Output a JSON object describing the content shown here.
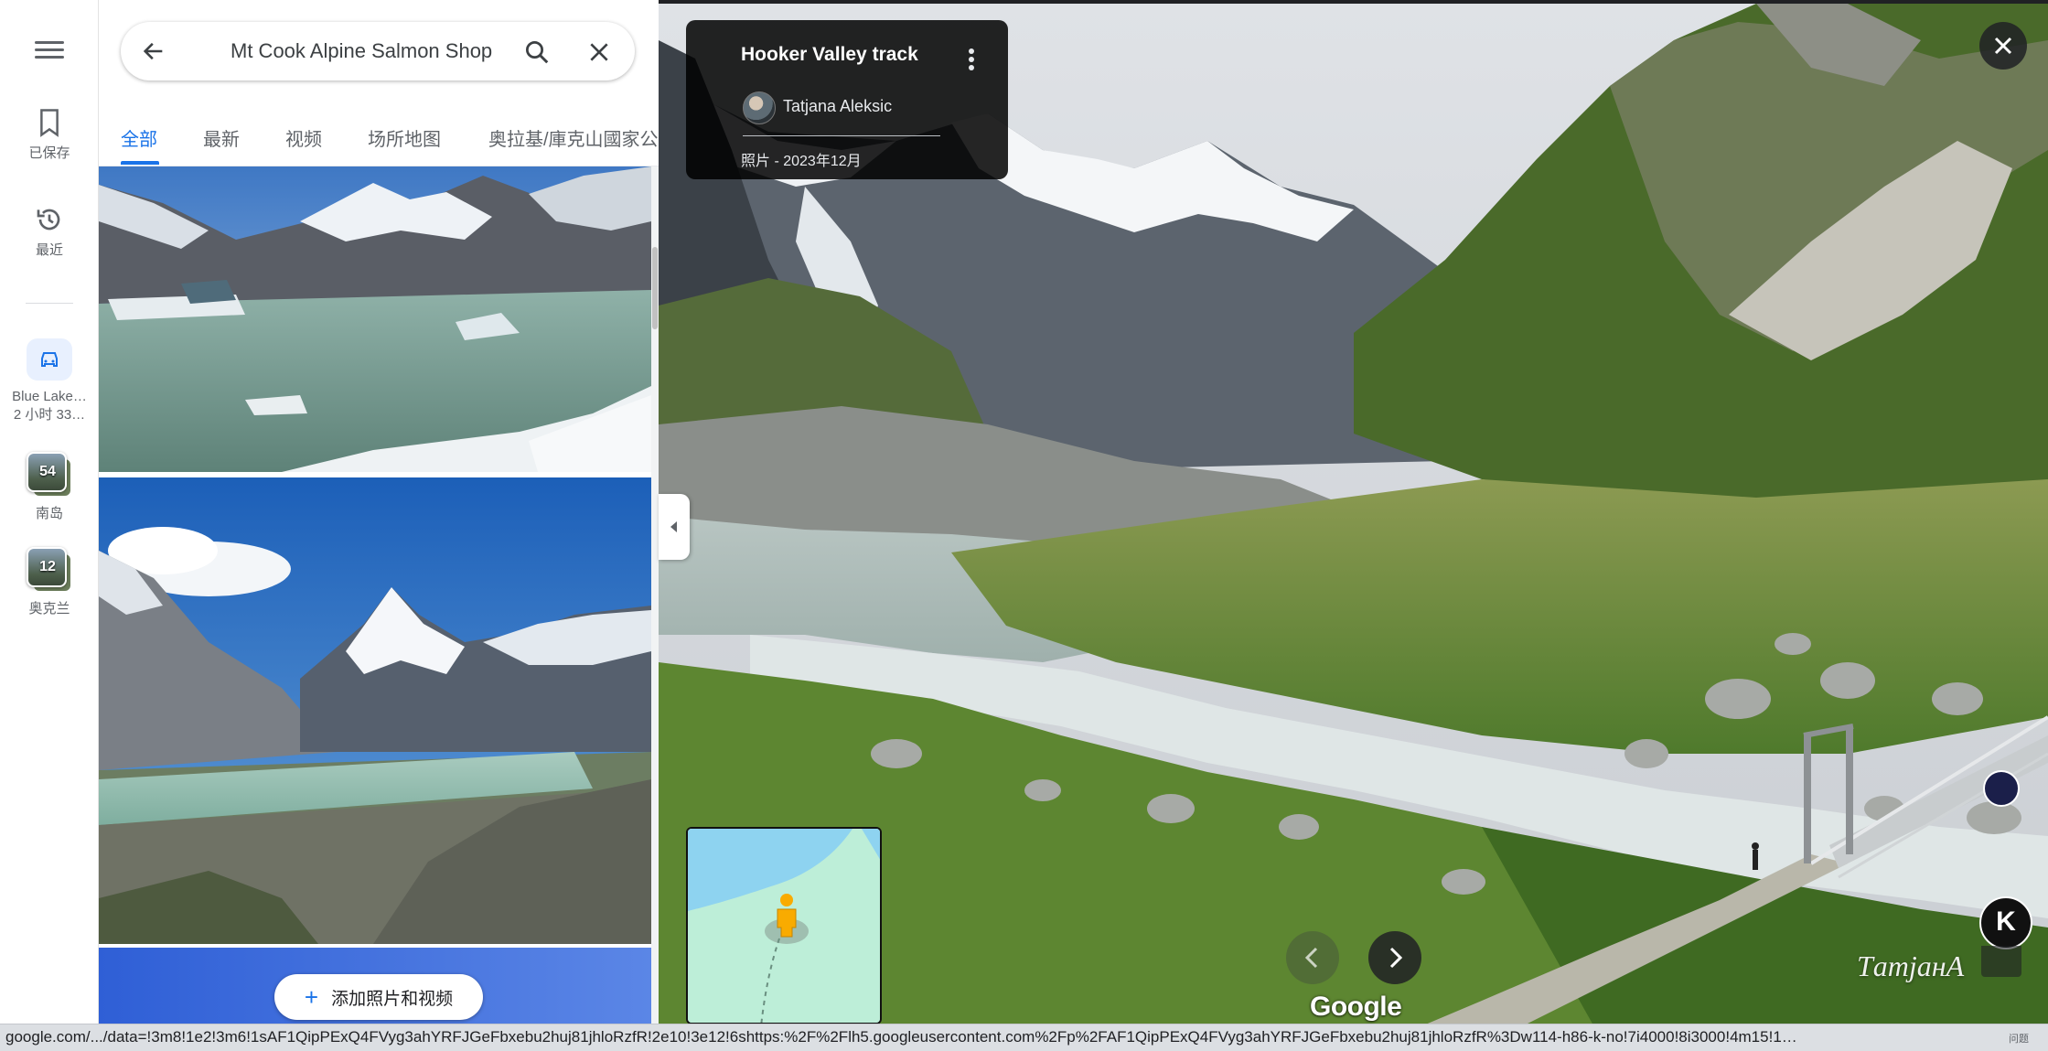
{
  "rail": {
    "saved_label": "已保存",
    "recent_label": "最近",
    "trip_title": "Blue Lake…",
    "trip_sub": "2 小时 33…",
    "lists": [
      {
        "count": "54",
        "label": "南岛"
      },
      {
        "count": "12",
        "label": "奥克兰"
      }
    ]
  },
  "search": {
    "value": "Mt Cook Alpine Salmon Shop"
  },
  "tabs": [
    {
      "label": "全部",
      "active": true
    },
    {
      "label": "最新"
    },
    {
      "label": "视频"
    },
    {
      "label": "场所地图"
    },
    {
      "label": "奥拉基/庫克山國家公园"
    }
  ],
  "add_photos_label": "添加照片和视频",
  "viewer": {
    "title": "Hooker Valley track",
    "author": "Tatjana Aleksic",
    "meta": "照片 - 2023年12月",
    "brand": "Google",
    "watermark": "TатjанA",
    "ext_k": "K"
  },
  "status_url": "google.com/.../data=!3m8!1e2!3m6!1sAF1QipPExQ4FVyg3ahYRFJGeFbxebu2huj81jhloRzfR!2e10!3e12!6shttps:%2F%2Flh5.googleusercontent.com%2Fp%2FAF1QipPExQ4FVyg3ahYRFJGeFbxebu2huj81jhloRzfR%3Dw114-h86-k-no!7i4000!8i3000!4m15!1…",
  "corner_text": "问题",
  "colors": {
    "accent": "#1a73e8",
    "card_bg": "#000000",
    "text_secondary": "#5f6368"
  }
}
